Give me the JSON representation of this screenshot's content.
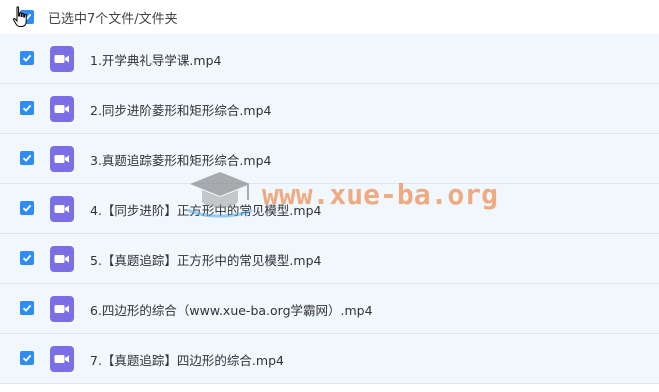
{
  "header": {
    "selection_label": "已选中7个文件/文件夹"
  },
  "files": [
    {
      "name": "1.开学典礼导学课.mp4"
    },
    {
      "name": "2.同步进阶菱形和矩形综合.mp4"
    },
    {
      "name": "3.真题追踪菱形和矩形综合.mp4"
    },
    {
      "name": "4.【同步进阶】正方形中的常见模型.mp4"
    },
    {
      "name": "5.【真题追踪】正方形中的常见模型.mp4"
    },
    {
      "name": "6.四边形的综合（www.xue-ba.org学霸网）.mp4"
    },
    {
      "name": "7.【真题追踪】四边形的综合.mp4"
    }
  ],
  "watermark": {
    "text": "www.xue-ba.org"
  },
  "colors": {
    "checkbox": "#2f8cf4",
    "video_icon": "#7b6fe6",
    "row_bg": "#f0f7fd"
  },
  "icons": {
    "file": "video-file-icon",
    "cursor": "hand-pointer-icon"
  }
}
